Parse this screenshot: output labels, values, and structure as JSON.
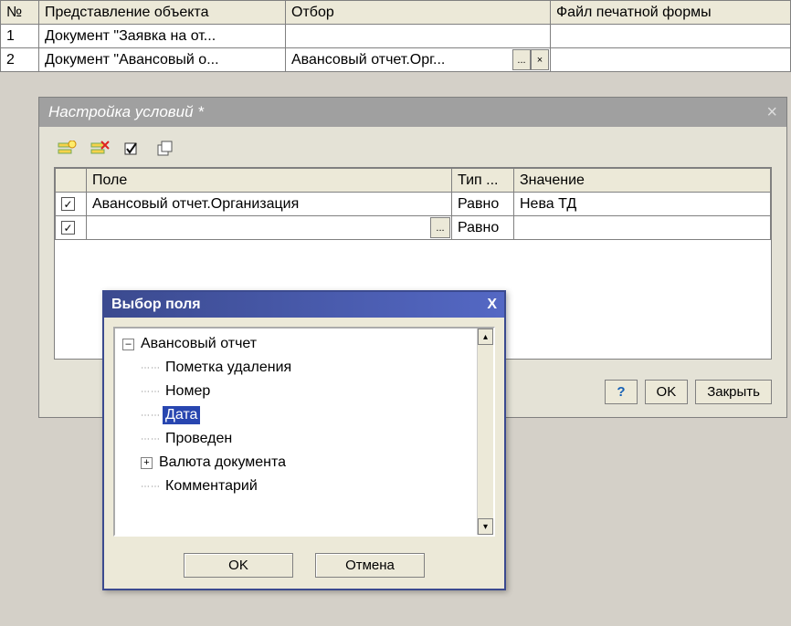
{
  "top_grid": {
    "headers": {
      "num": "№",
      "repr": "Представление объекта",
      "filter": "Отбор",
      "file": "Файл печатной формы"
    },
    "rows": [
      {
        "num": "1",
        "repr": "Документ \"Заявка на от...",
        "filter": "",
        "file": ""
      },
      {
        "num": "2",
        "repr": "Документ \"Авансовый о...",
        "filter": "Авансовый отчет.Орг...",
        "file": ""
      }
    ],
    "ellipsis": "...",
    "clear": "×"
  },
  "settings": {
    "title": "Настройка условий *",
    "close": "×",
    "headers": {
      "field": "Поле",
      "type": "Тип ...",
      "value": "Значение"
    },
    "rows": [
      {
        "checked": true,
        "field": "Авансовый отчет.Организация",
        "type": "Равно",
        "value": "Нева ТД"
      },
      {
        "checked": true,
        "field": "",
        "type": "Равно",
        "value": ""
      }
    ],
    "ellipsis": "...",
    "buttons": {
      "help": "?",
      "ok": "OK",
      "close": "Закрыть"
    }
  },
  "picker": {
    "title": "Выбор поля",
    "close": "X",
    "root": "Авансовый отчет",
    "items": [
      {
        "label": "Пометка удаления",
        "expand": null,
        "selected": false
      },
      {
        "label": "Номер",
        "expand": null,
        "selected": false
      },
      {
        "label": "Дата",
        "expand": null,
        "selected": true
      },
      {
        "label": "Проведен",
        "expand": null,
        "selected": false
      },
      {
        "label": "Валюта документа",
        "expand": "+",
        "selected": false
      },
      {
        "label": "Комментарий",
        "expand": null,
        "selected": false
      }
    ],
    "buttons": {
      "ok": "OK",
      "cancel": "Отмена"
    },
    "root_expand": "–",
    "scroll_up": "▴",
    "scroll_down": "▾"
  },
  "checkmark": "✓"
}
